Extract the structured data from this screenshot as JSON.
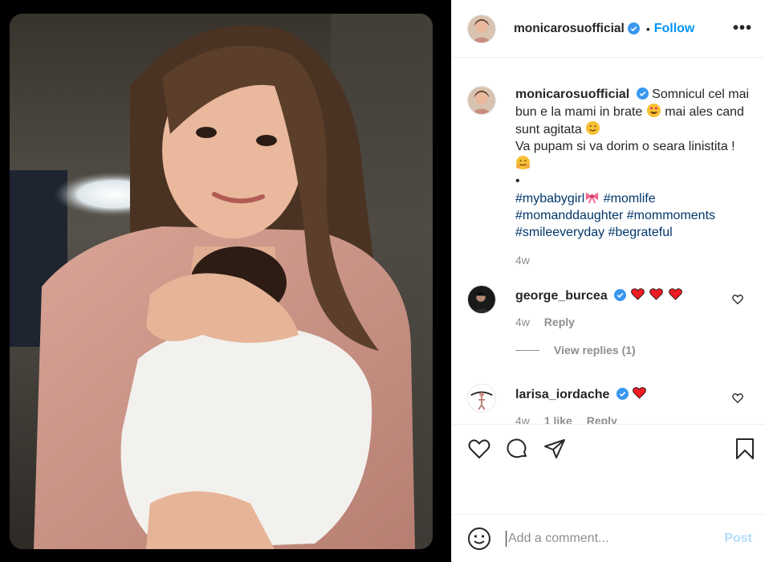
{
  "post": {
    "username": "monicarosuofficial",
    "follow_label": "Follow",
    "separator": "•",
    "more_label": "•••"
  },
  "caption": {
    "username": "monicarosuofficial",
    "text_1": "Somnicul cel mai bun e la mami in brate",
    "text_2": "mai ales cand sunt agitata",
    "text_3": "Va pupam si va dorim o seara linistita !",
    "bullet": "•",
    "hashtags": [
      "#mybabygirl",
      "#momlife",
      "#momanddaughter",
      "#mommoments",
      "#smileeveryday",
      "#begrateful"
    ],
    "time": "4w"
  },
  "comments": [
    {
      "username": "george_burcea",
      "hearts": 3,
      "time": "4w",
      "reply_label": "Reply",
      "view_replies": "View replies (1)"
    },
    {
      "username": "larisa_iordache",
      "hearts": 1,
      "time": "4w",
      "likes": "1 like",
      "reply_label": "Reply"
    }
  ],
  "add_comment": {
    "placeholder": "Add a comment...",
    "post_label": "Post"
  },
  "icons": [
    "verified-badge-icon",
    "heart-icon",
    "comment-icon",
    "share-icon",
    "bookmark-icon",
    "emoji-icon",
    "small-heart-icon"
  ],
  "colors": {
    "accent": "#0095f6",
    "hashtag": "#00376b",
    "muted": "#8e8e8e",
    "heart_red": "#ed1c24"
  }
}
